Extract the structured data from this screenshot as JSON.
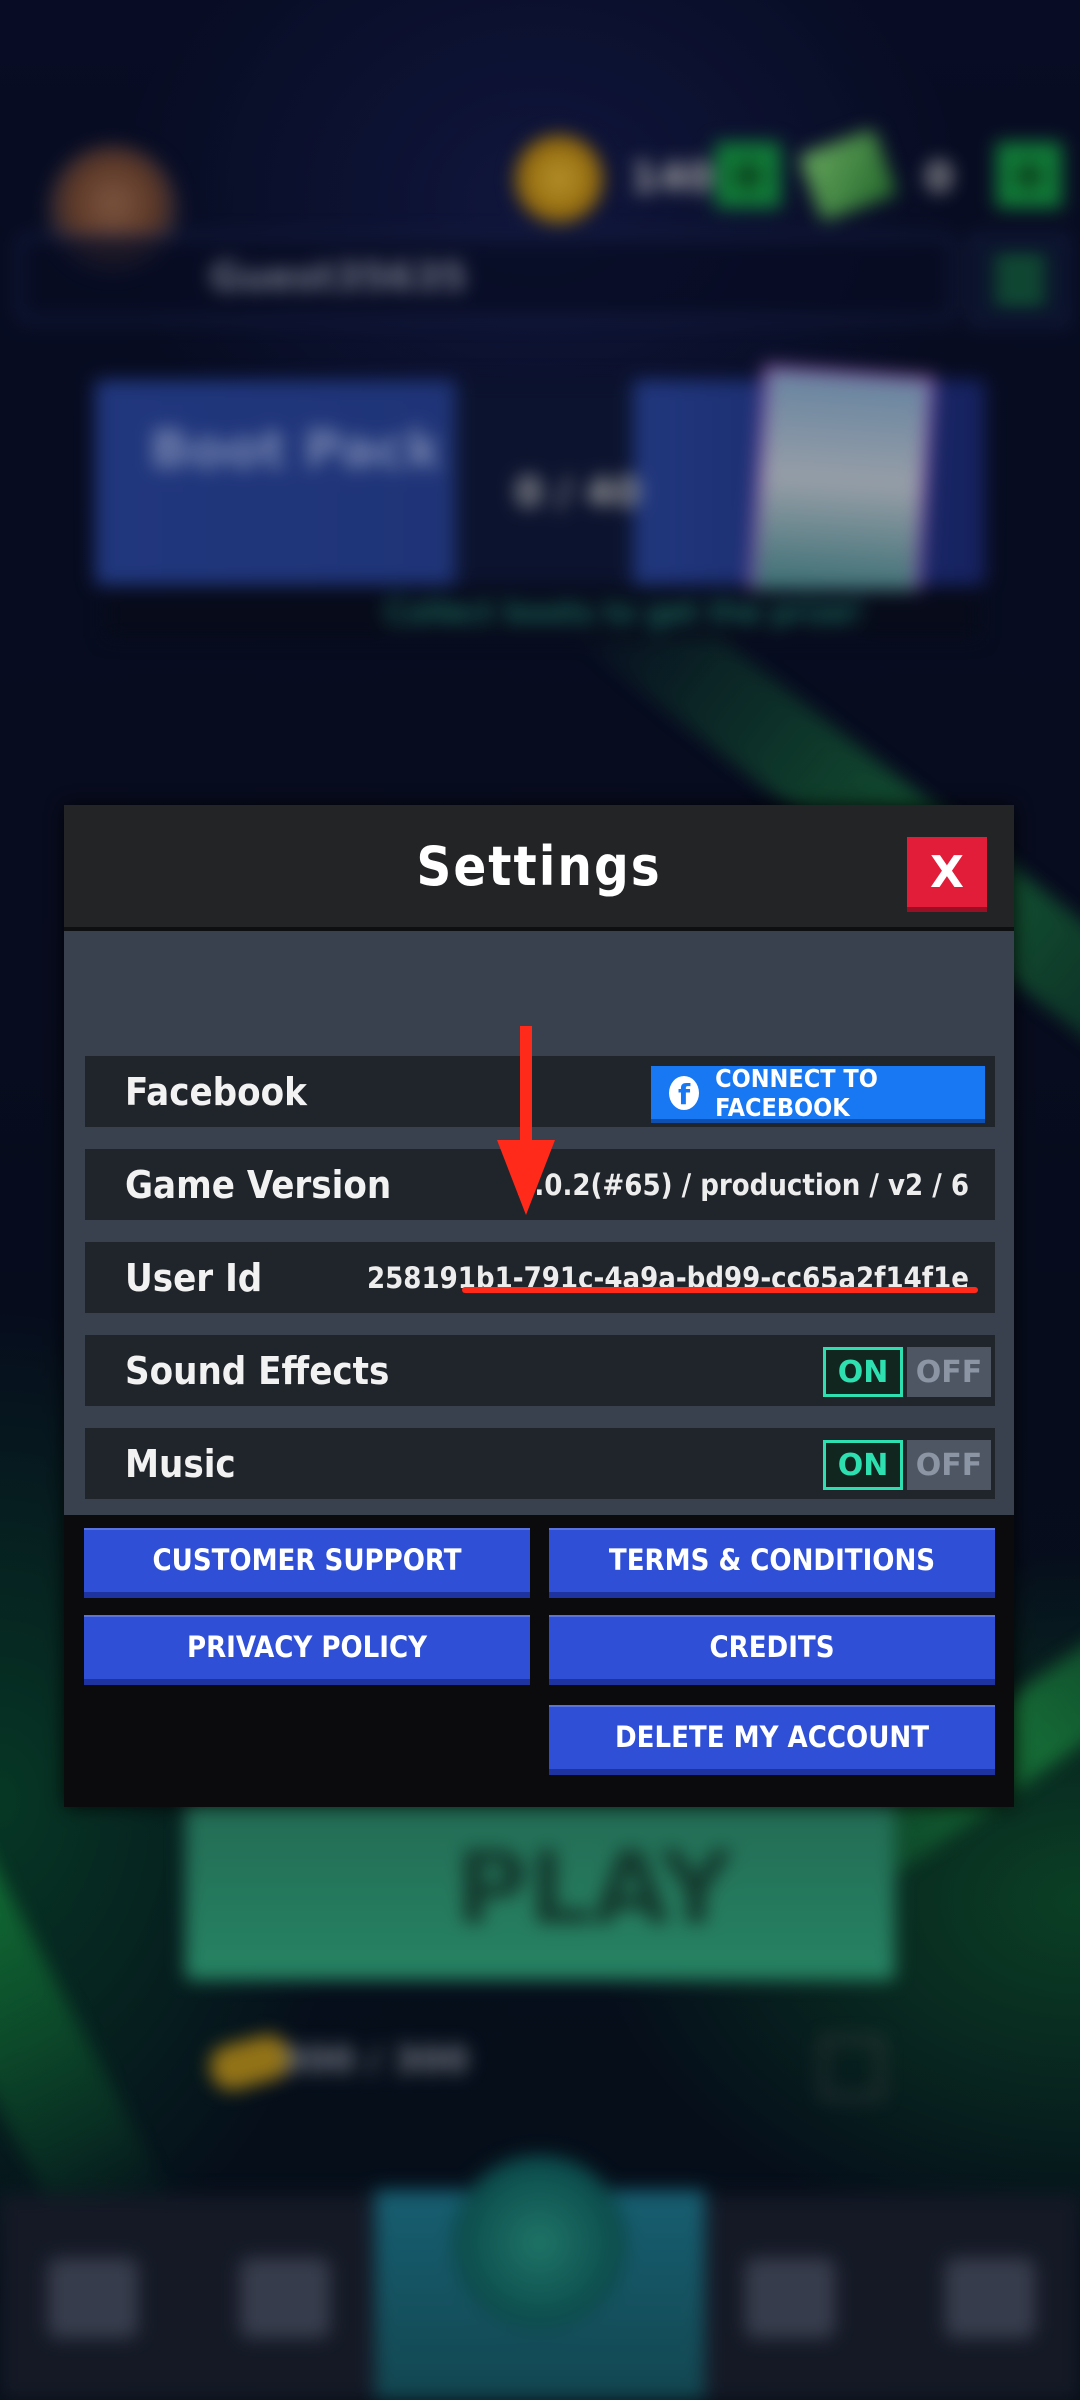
{
  "background": {
    "player_name": "Guest35635",
    "coins": "140",
    "cash": "0",
    "pack": {
      "title": "Boot Pack",
      "progress": "0 / 40",
      "hint": "Collect boots to get the prize!"
    },
    "play_label": "PLAY",
    "energy": "300 / 300"
  },
  "settings": {
    "title": "Settings",
    "close_label": "X",
    "rows": {
      "facebook": {
        "label": "Facebook",
        "button": "CONNECT TO FACEBOOK",
        "icon": "f"
      },
      "game_version": {
        "label": "Game Version",
        "value": "2.0.2(#65) / production / v2 / 6"
      },
      "user_id": {
        "label": "User Id",
        "value": "258191b1-791c-4a9a-bd99-cc65a2f14f1e"
      },
      "sound_effects": {
        "label": "Sound Effects",
        "on": "ON",
        "off": "OFF",
        "state": "on"
      },
      "music": {
        "label": "Music",
        "on": "ON",
        "off": "OFF",
        "state": "on"
      }
    },
    "buttons": {
      "customer_support": "CUSTOMER SUPPORT",
      "terms": "TERMS & CONDITIONS",
      "privacy": "PRIVACY POLICY",
      "credits": "CREDITS",
      "delete_account": "DELETE MY ACCOUNT"
    }
  },
  "annotation_color": "#ff2a1a"
}
